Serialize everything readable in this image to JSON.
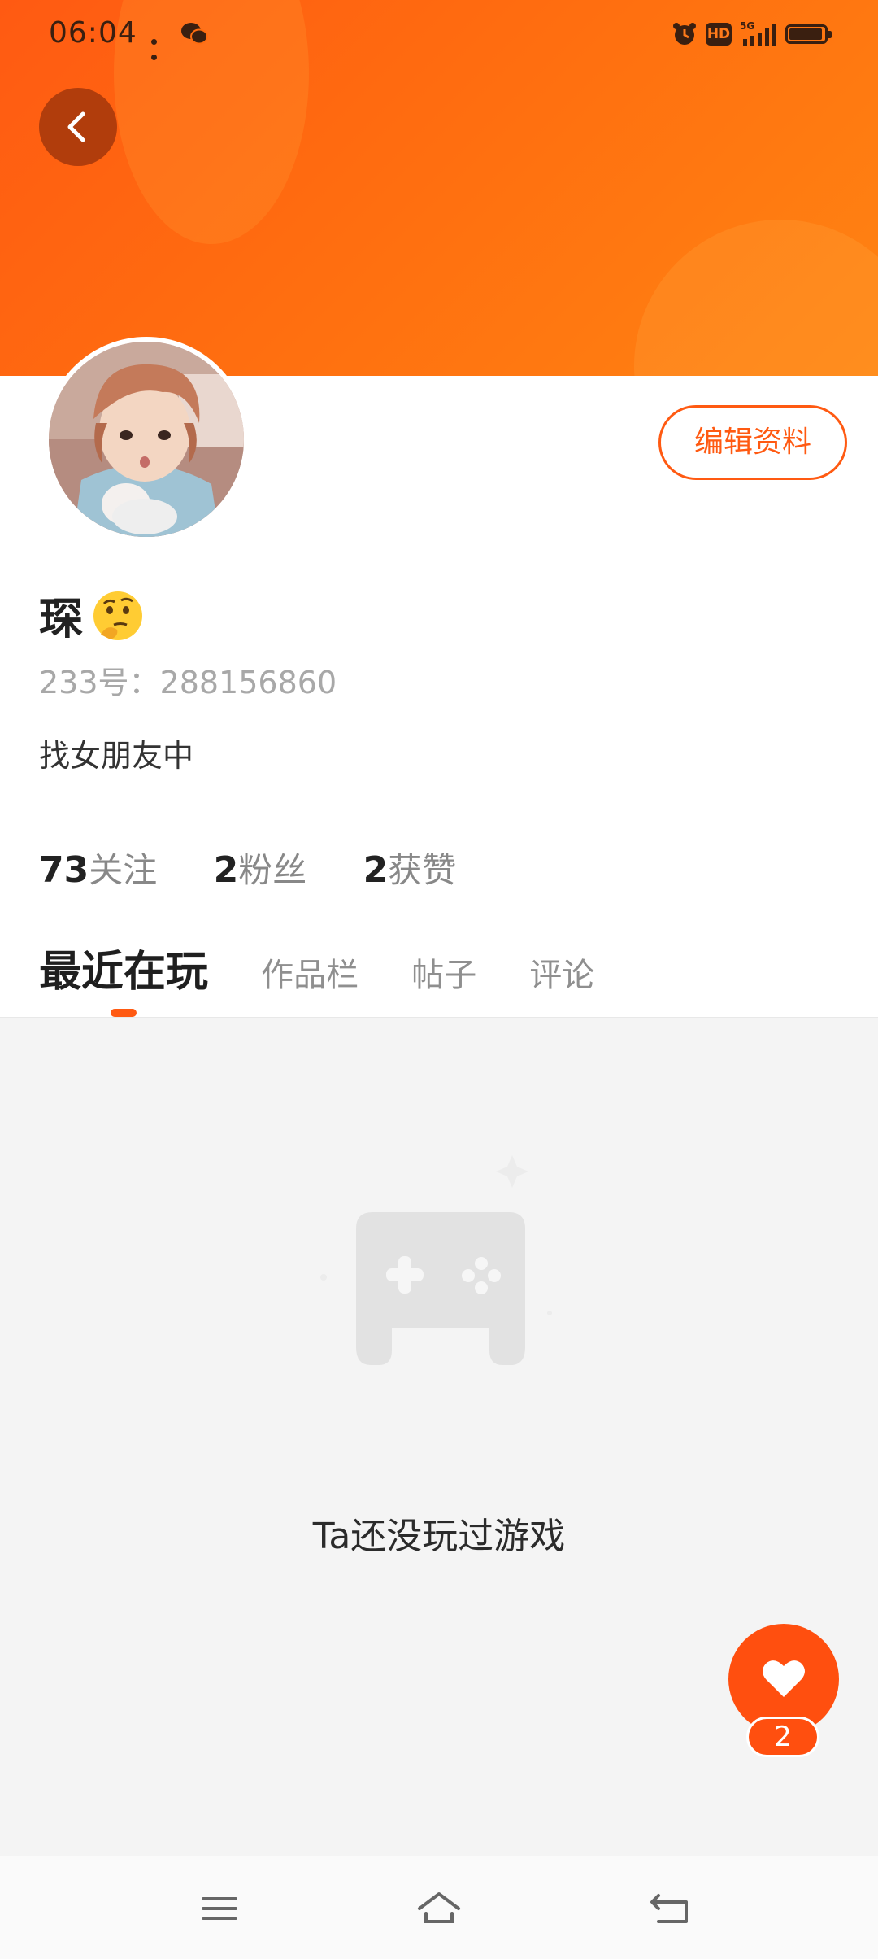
{
  "status_bar": {
    "time": "06:04",
    "hd_label": "HD",
    "network_label": "5G"
  },
  "profile": {
    "edit_label": "编辑资料",
    "name": "琛",
    "id_text": "233号：288156860",
    "bio": "找女朋友中"
  },
  "stats": [
    {
      "num": "73",
      "label": "关注"
    },
    {
      "num": "2",
      "label": "粉丝"
    },
    {
      "num": "2",
      "label": "获赞"
    }
  ],
  "tabs": [
    {
      "label": "最近在玩",
      "active": true
    },
    {
      "label": "作品栏",
      "active": false
    },
    {
      "label": "帖子",
      "active": false
    },
    {
      "label": "评论",
      "active": false
    }
  ],
  "empty_state": {
    "message": "Ta还没玩过游戏"
  },
  "like": {
    "count": "2"
  },
  "colors": {
    "accent": "#ff5a12",
    "header_start": "#ff5a12",
    "header_end": "#ff8412",
    "content_bg": "#f4f4f4"
  },
  "icons": {
    "back": "chevron-left-icon",
    "like": "heart-icon",
    "empty": "gamepad-icon",
    "nav": [
      "menu-icon",
      "home-icon",
      "back-nav-icon"
    ]
  }
}
